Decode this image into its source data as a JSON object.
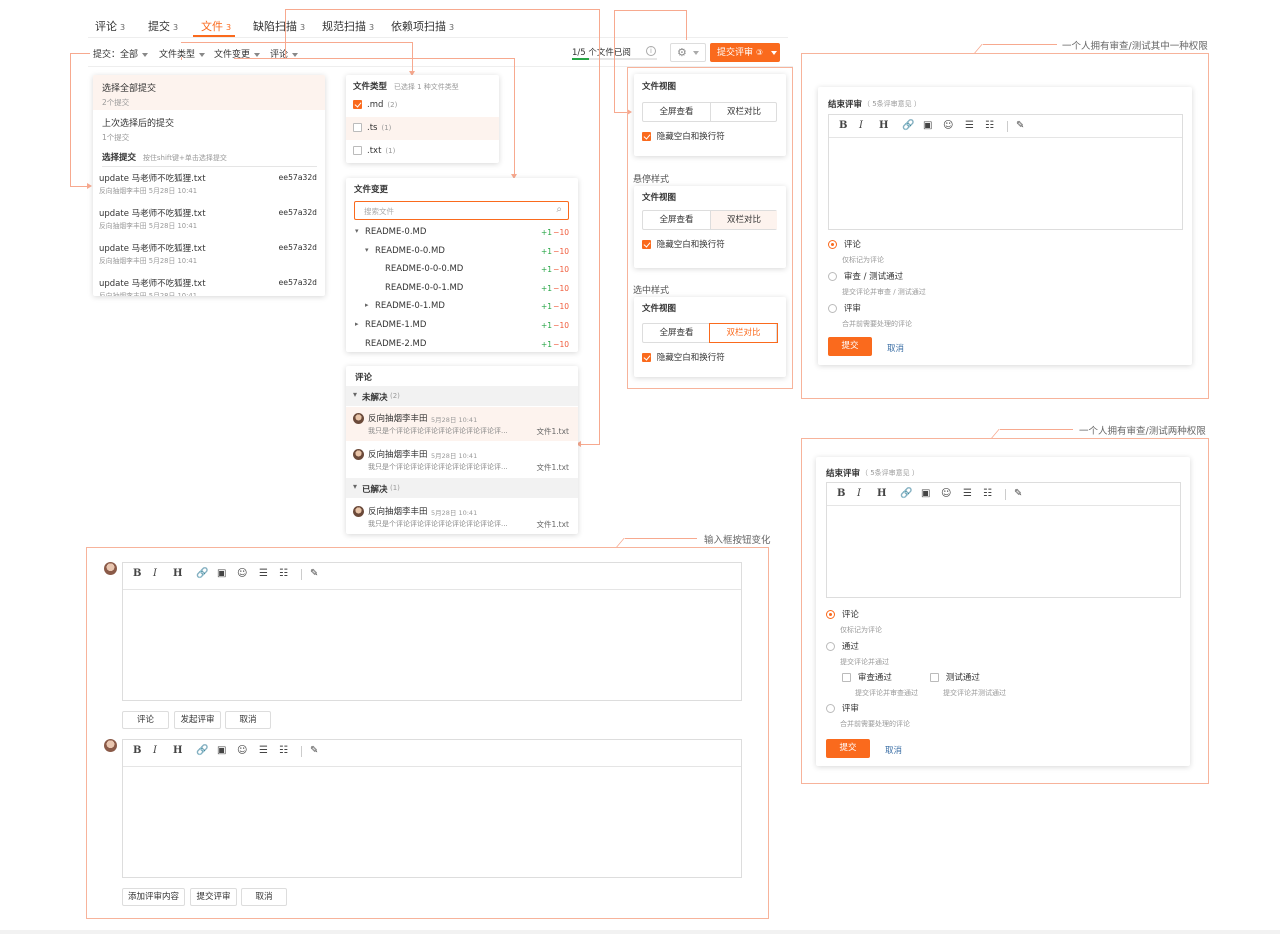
{
  "tabs": [
    {
      "label": "评论",
      "count": "3"
    },
    {
      "label": "提交",
      "count": "3"
    },
    {
      "label": "文件",
      "count": "3"
    },
    {
      "label": "缺陷扫描",
      "count": "3"
    },
    {
      "label": "规范扫描",
      "count": "3"
    },
    {
      "label": "依赖项扫描",
      "count": "3"
    }
  ],
  "filters": {
    "commit": "提交：全部",
    "file_type": "文件类型",
    "file_change": "文件变更",
    "comment": "评论"
  },
  "progress": {
    "text": "1/5 个文件已阅",
    "fraction": 0.2
  },
  "submit_review": {
    "label": "提交评审",
    "count": "③"
  },
  "commit_dropdown": {
    "all": {
      "title": "选择全部提交",
      "sub": "2个提交"
    },
    "since_last": {
      "title": "上次选择后的提交",
      "sub": "1个提交"
    },
    "select_header": "选择提交",
    "select_hint": "按住shift键+单击选择提交",
    "commits": [
      {
        "title": "update 马老师不吃狐狸.txt",
        "hash": "ee57a32d",
        "meta": "反向抽烟李丰田 5月28日 10:41"
      },
      {
        "title": "update 马老师不吃狐狸.txt",
        "hash": "ee57a32d",
        "meta": "反向抽烟李丰田 5月28日 10:41"
      },
      {
        "title": "update 马老师不吃狐狸.txt",
        "hash": "ee57a32d",
        "meta": "反向抽烟李丰田 5月28日 10:41"
      },
      {
        "title": "update 马老师不吃狐狸.txt",
        "hash": "ee57a32d",
        "meta": "反向抽烟李丰田 5月28日 10:41"
      }
    ]
  },
  "file_type_dropdown": {
    "title": "文件类型",
    "hint": "已选择 1 种文件类型",
    "items": [
      {
        "ext": ".md",
        "count": "(2)",
        "checked": true
      },
      {
        "ext": ".ts",
        "count": "(1)",
        "checked": false
      },
      {
        "ext": ".txt",
        "count": "(1)",
        "checked": false
      }
    ]
  },
  "file_change_dropdown": {
    "title": "文件变更",
    "search_placeholder": "搜索文件",
    "files": [
      {
        "name": "README-0.MD",
        "add": "+1",
        "del": "−10",
        "arrow": "▾"
      },
      {
        "name": "README-0-0.MD",
        "add": "+1",
        "del": "−10",
        "arrow": "▾"
      },
      {
        "name": "README-0-0-0.MD",
        "add": "+1",
        "del": "−10",
        "arrow": ""
      },
      {
        "name": "README-0-0-1.MD",
        "add": "+1",
        "del": "−10",
        "arrow": ""
      },
      {
        "name": "README-0-1.MD",
        "add": "+1",
        "del": "−10",
        "arrow": "▸"
      },
      {
        "name": "README-1.MD",
        "add": "+1",
        "del": "−10",
        "arrow": "▸"
      },
      {
        "name": "README-2.MD",
        "add": "+1",
        "del": "−10",
        "arrow": ""
      }
    ]
  },
  "comment_dropdown": {
    "title": "评论",
    "unresolved": {
      "label": "未解决",
      "count": "(2)"
    },
    "resolved": {
      "label": "已解决",
      "count": "(1)"
    },
    "comments": [
      {
        "author": "反向抽烟李丰田",
        "time": "5月28日 10:41",
        "text": "我只是个评论评论评论评论评论评论评论评...",
        "file": "文件1.txt"
      },
      {
        "author": "反向抽烟李丰田",
        "time": "5月28日 10:41",
        "text": "我只是个评论评论评论评论评论评论评论评...",
        "file": "文件1.txt"
      },
      {
        "author": "反向抽烟李丰田",
        "time": "5月28日 10:41",
        "text": "我只是个评论评论评论评论评论评论评论评...",
        "file": "文件1.txt"
      }
    ]
  },
  "file_view": {
    "title": "文件视图",
    "fullscreen": "全屏查看",
    "split": "双栏对比",
    "hide_whitespace": "隐藏空白和换行符",
    "hover_label": "悬停样式",
    "selected_label": "选中样式"
  },
  "editor_toolbar": [
    "B",
    "I",
    "H",
    "🔗",
    "▣",
    "☺",
    "☰",
    "☷",
    "✎"
  ],
  "input_section": {
    "label": "输入框按钮变化",
    "buttons_a": [
      "评论",
      "发起评审",
      "取消"
    ],
    "buttons_b": [
      "添加评审内容",
      "提交评审",
      "取消"
    ]
  },
  "end_review_one": {
    "section_label": "一个人拥有审查/测试其中一种权限",
    "title": "结束评审",
    "hint": "（ 5条评审意见 ）",
    "options": [
      {
        "label": "评论",
        "desc": "仅标记为评论",
        "selected": true
      },
      {
        "label": "审查 / 测试通过",
        "desc": "提交评论并审查 / 测试通过",
        "selected": false
      },
      {
        "label": "评审",
        "desc": "合并前需要处理的评论",
        "selected": false
      }
    ],
    "submit": "提交",
    "cancel": "取消"
  },
  "end_review_two": {
    "section_label": "一个人拥有审查/测试两种权限",
    "title": "结束评审",
    "hint": "（ 5条评审意见 ）",
    "comment": {
      "label": "评论",
      "desc": "仅标记为评论"
    },
    "pass": {
      "label": "通过",
      "desc": "提交评论并通过"
    },
    "review_pass": {
      "label": "审查通过",
      "desc": "提交评论并审查通过"
    },
    "test_pass": {
      "label": "测试通过",
      "desc": "提交评论并测试通过"
    },
    "review": {
      "label": "评审",
      "desc": "合并前需要处理的评论"
    },
    "submit": "提交",
    "cancel": "取消"
  },
  "colors": {
    "accent": "#fa6a1d",
    "annotation": "#f7a98f",
    "add": "#27a546",
    "del": "#f05a3a"
  }
}
